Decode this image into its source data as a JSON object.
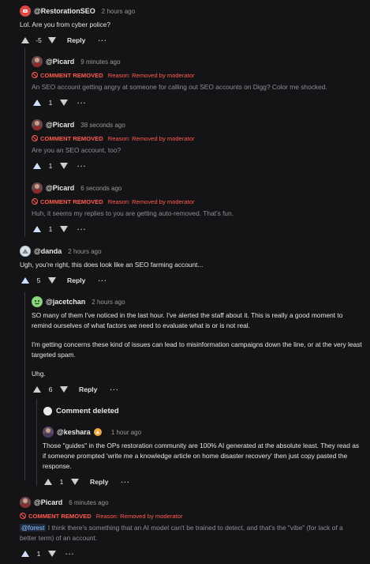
{
  "comments": {
    "c1": {
      "user": "@RestorationSEO",
      "time": "2 hours ago",
      "text": "Lol. Are you from cyber police?",
      "score": "-5",
      "reply": "Reply",
      "more": "···"
    },
    "c2": {
      "user": "@Picard",
      "time": "9 minutes ago",
      "removed_label": "COMMENT REMOVED",
      "removed_reason": "Reason: Removed by moderator",
      "text": "An SEO account getting angry at someone for calling out SEO accounts on Digg? Color me shocked.",
      "score": "1",
      "more": "···"
    },
    "c3": {
      "user": "@Picard",
      "time": "38 seconds ago",
      "removed_label": "COMMENT REMOVED",
      "removed_reason": "Reason: Removed by moderator",
      "text": "Are you an SEO account, too?",
      "score": "1",
      "more": "···"
    },
    "c4": {
      "user": "@Picard",
      "time": "6 seconds ago",
      "removed_label": "COMMENT REMOVED",
      "removed_reason": "Reason: Removed by moderator",
      "text": "Huh, it seems my replies to you are getting auto-removed. That's fun.",
      "score": "1",
      "more": "···"
    },
    "c5": {
      "user": "@danda",
      "time": "2 hours ago",
      "text": "Ugh, you're right, this does look like an SEO farming account...",
      "score": "5",
      "reply": "Reply",
      "more": "···"
    },
    "c6": {
      "user": "@jacetchan",
      "time": "2 hours ago",
      "p1": "SO many of them I've noticed in the last hour. I've alerted the staff about it. This is really a good moment to remind ourselves of what factors we need to evaluate what is or is not real.",
      "p2": "I'm getting concerns these kind of issues can lead to misinformation campaigns down the line, or at the very least targeted spam.",
      "p3": "Uhg.",
      "score": "6",
      "reply": "Reply",
      "more": "···"
    },
    "c7": {
      "deleted_label": "Comment deleted"
    },
    "c8": {
      "user": "@keshara",
      "time": "1 hour ago",
      "text": "Those \"guides\" in the OPs restoration community are 100% AI generated at the absolute least. They read as if someone prompted 'write me a knowledge article on home disaster recovery' then just copy pasted the response.",
      "score": "1",
      "reply": "Reply",
      "more": "···"
    },
    "c9": {
      "user": "@Picard",
      "time": "6 minutes ago",
      "removed_label": "COMMENT REMOVED",
      "removed_reason": "Reason: Removed by moderator",
      "mention": "@forest",
      "text": " I think there's something that an AI model can't be trained to detect, and that's the \"vibe\" (for lack of a better term) of an account.",
      "score": "1",
      "more": "···"
    }
  },
  "icons": {
    "upvote": "upvote-icon",
    "downvote": "downvote-icon",
    "removed": "ban-icon",
    "avatar": "avatar"
  },
  "colors": {
    "background": "#141416",
    "removed": "#ff5a4f",
    "muted_text": "#8f8f95",
    "thread_line": "#3a3a3e",
    "mention": "#8cc0ff"
  }
}
